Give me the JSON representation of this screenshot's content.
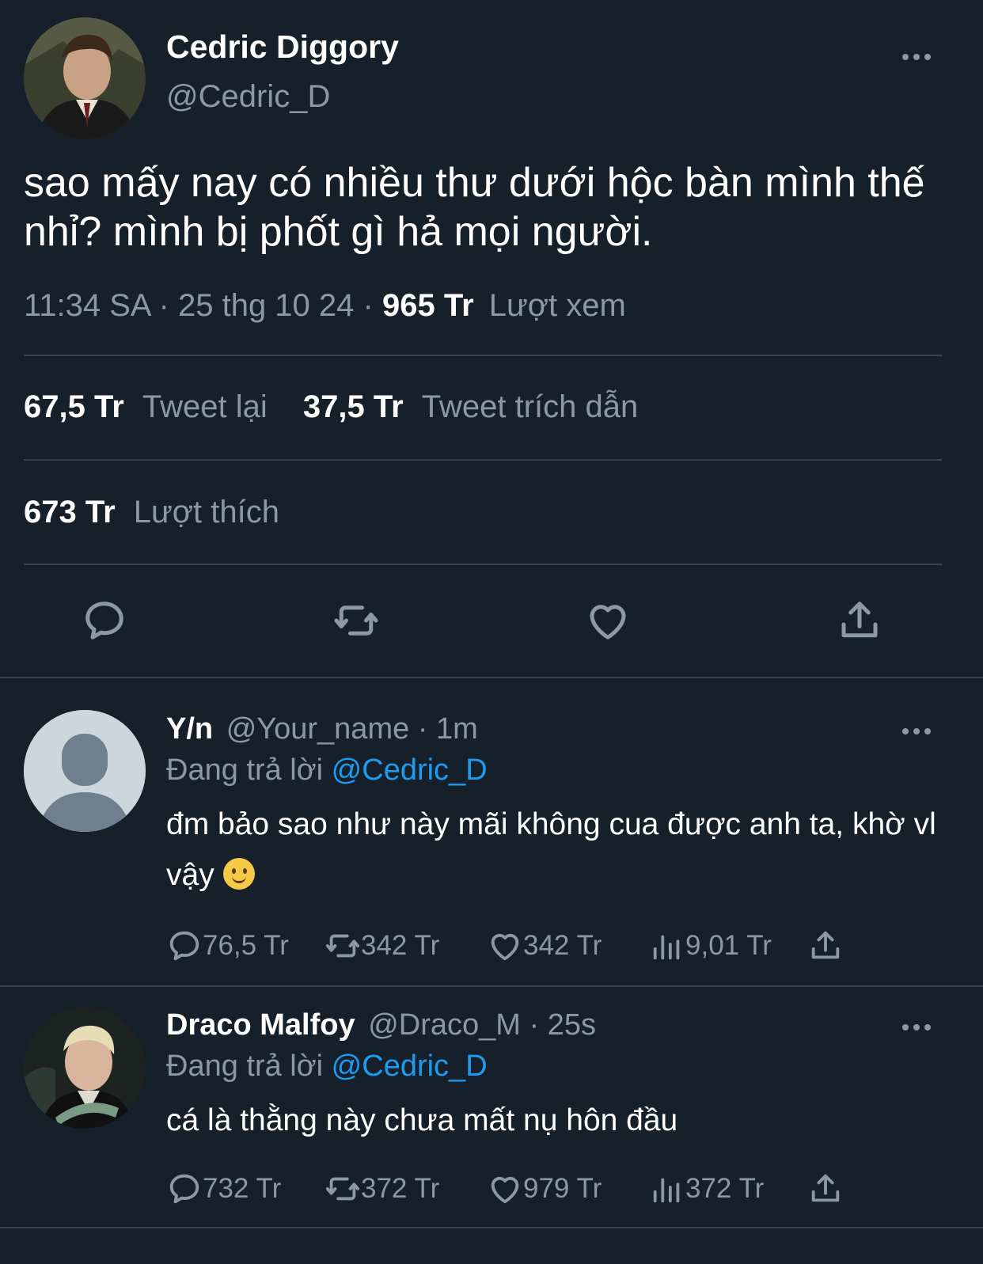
{
  "main_tweet": {
    "display_name": "Cedric Diggory",
    "handle": "@Cedric_D",
    "text": "sao mấy nay có nhiều thư dưới hộc bàn mình thế nhỉ? mình bị phốt gì hả mọi người.",
    "time": "11:34 SA",
    "date": "25 thg 10 24",
    "sep": "·",
    "views_count": "965 Tr",
    "views_label": "Lượt xem",
    "retweets_count": "67,5 Tr",
    "retweets_label": "Tweet lại",
    "quotes_count": "37,5 Tr",
    "quotes_label": "Tweet trích dẫn",
    "likes_count": "673 Tr",
    "likes_label": "Lượt thích",
    "actions": [
      "reply-icon",
      "retweet-icon",
      "like-icon",
      "share-icon"
    ]
  },
  "replies": [
    {
      "display_name": "Y/n",
      "handle": "@Your_name",
      "time": "1m",
      "reply_prefix": "Đang trả lời",
      "reply_to": "@Cedric_D",
      "text": "đm bảo sao như này mãi không cua được anh ta, khờ vl vậy",
      "emoji": "slightly-smiling-face",
      "stats": {
        "replies": "76,5 Tr",
        "retweets": "342 Tr",
        "likes": "342 Tr",
        "views": "9,01 Tr"
      }
    },
    {
      "display_name": "Draco Malfoy",
      "handle": "@Draco_M",
      "time": "25s",
      "reply_prefix": "Đang trả lời",
      "reply_to": "@Cedric_D",
      "text": "cá là thằng này chưa mất nụ hôn đầu",
      "stats": {
        "replies": "732 Tr",
        "retweets": "372 Tr",
        "likes": "979 Tr",
        "views": "372 Tr"
      }
    }
  ],
  "colors": {
    "background": "#15202b",
    "muted": "#8b98a5",
    "link": "#1d9bf0",
    "divider": "#38444d"
  }
}
